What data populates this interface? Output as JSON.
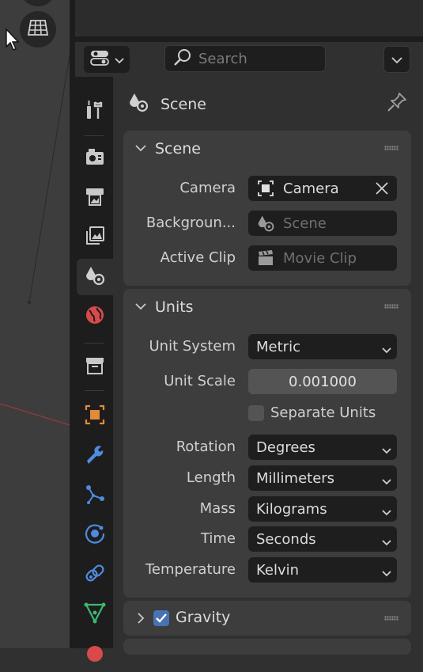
{
  "header": {
    "search_placeholder": "Search"
  },
  "context": {
    "label": "Scene"
  },
  "scene_panel": {
    "title": "Scene",
    "camera_label": "Camera",
    "camera_value": "Camera",
    "background_label": "Backgroun...",
    "background_placeholder": "Scene",
    "active_clip_label": "Active Clip",
    "active_clip_placeholder": "Movie Clip"
  },
  "units_panel": {
    "title": "Units",
    "unit_system_label": "Unit System",
    "unit_system_value": "Metric",
    "unit_scale_label": "Unit Scale",
    "unit_scale_value": "0.001000",
    "separate_units_label": "Separate Units",
    "separate_units_checked": false,
    "rotation_label": "Rotation",
    "rotation_value": "Degrees",
    "length_label": "Length",
    "length_value": "Millimeters",
    "mass_label": "Mass",
    "mass_value": "Kilograms",
    "time_label": "Time",
    "time_value": "Seconds",
    "temperature_label": "Temperature",
    "temperature_value": "Kelvin"
  },
  "gravity_panel": {
    "title": "Gravity",
    "enabled": true
  },
  "tabs": [
    {
      "name": "tool",
      "icon": "tool-icon"
    },
    {
      "name": "render",
      "icon": "render-icon"
    },
    {
      "name": "output",
      "icon": "output-icon"
    },
    {
      "name": "view-layer",
      "icon": "view-layer-icon"
    },
    {
      "name": "scene",
      "icon": "scene-icon",
      "active": true
    },
    {
      "name": "world",
      "icon": "world-icon"
    },
    {
      "name": "collection",
      "icon": "collection-icon"
    },
    {
      "name": "object",
      "icon": "object-icon"
    },
    {
      "name": "modifiers",
      "icon": "wrench-icon"
    },
    {
      "name": "particles",
      "icon": "particles-icon"
    },
    {
      "name": "physics",
      "icon": "physics-icon"
    },
    {
      "name": "constraints",
      "icon": "constraint-icon"
    },
    {
      "name": "data",
      "icon": "mesh-data-icon"
    }
  ],
  "colors": {
    "accent_blue": "#4772b3",
    "object_orange": "#e08a3a",
    "modifier_blue": "#4f8be0",
    "mesh_green": "#3fb872",
    "world_red": "#d84a4a"
  }
}
